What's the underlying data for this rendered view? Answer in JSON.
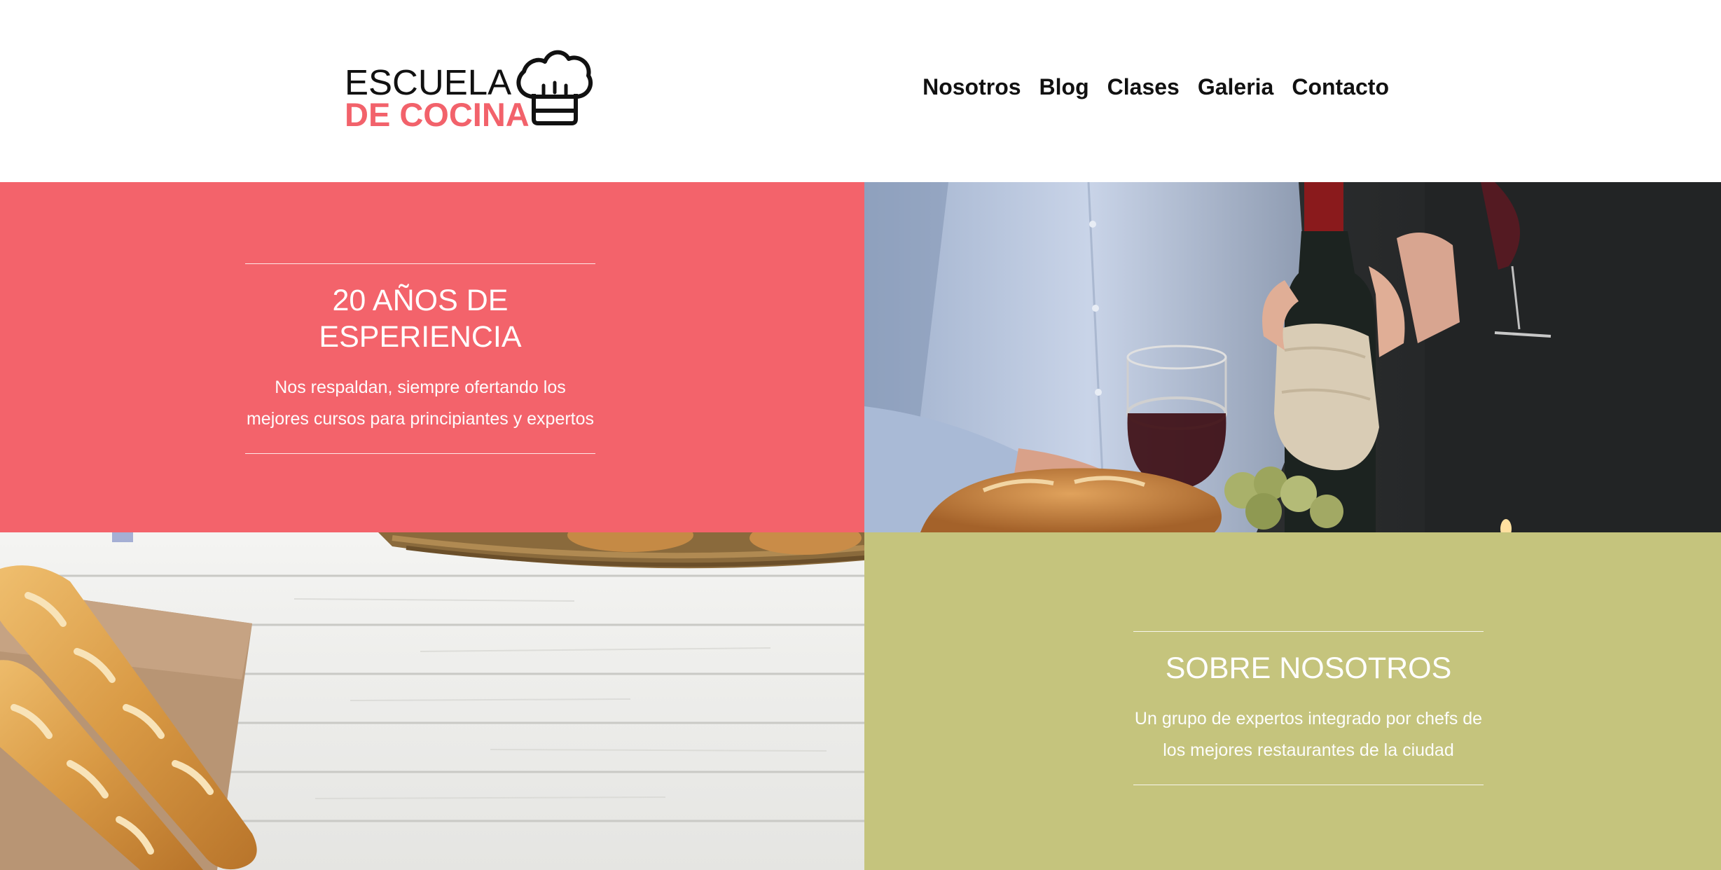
{
  "brand": {
    "line1": "ESCUELA",
    "line2": "DE COCINA",
    "icon": "chef-hat-icon",
    "accent_color": "#f2626b"
  },
  "nav": {
    "items": [
      {
        "label": "Nosotros"
      },
      {
        "label": "Blog"
      },
      {
        "label": "Clases"
      },
      {
        "label": "Galeria"
      },
      {
        "label": "Contacto"
      }
    ]
  },
  "experience": {
    "title": "20 AÑOS DE ESPERIENCIA",
    "text": "Nos respaldan, siempre ofertando los mejores cursos para principiantes y expertos",
    "background": "#f3636b"
  },
  "about": {
    "title": "SOBRE NOSOTROS",
    "text": "Un grupo de expertos integrado por chefs de los mejores restaurantes de la ciudad",
    "background": "#c5c47d"
  },
  "images": {
    "wine": "wine-photo",
    "bread": "bread-photo"
  }
}
